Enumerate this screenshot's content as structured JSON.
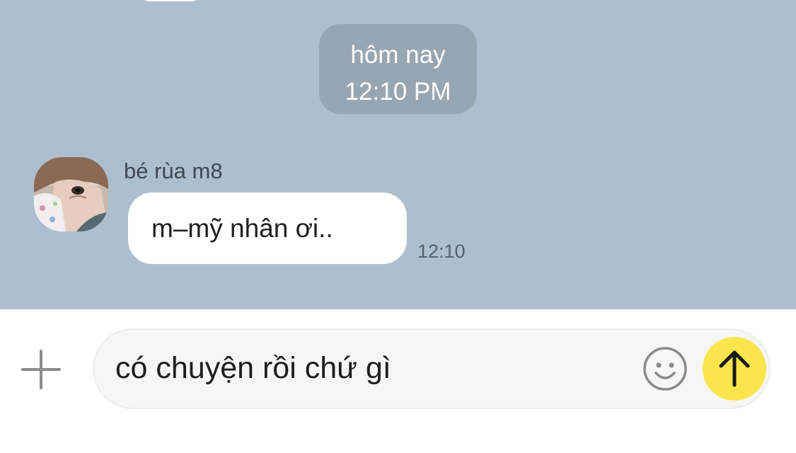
{
  "date_separator": {
    "day": "hôm nay",
    "time": "12:10 PM"
  },
  "message": {
    "sender": "bé rùa m8",
    "text": "m–mỹ nhân ơi..",
    "time": "12:10"
  },
  "composer": {
    "value": "có chuyện rồi chứ gì",
    "plus_icon": "plus-icon",
    "emoji_icon": "smiley-icon",
    "send_icon": "arrow-up-icon"
  },
  "colors": {
    "chat_background": "#adbfcf",
    "date_pill": "#97a6b3",
    "send_button": "#fae54d"
  }
}
